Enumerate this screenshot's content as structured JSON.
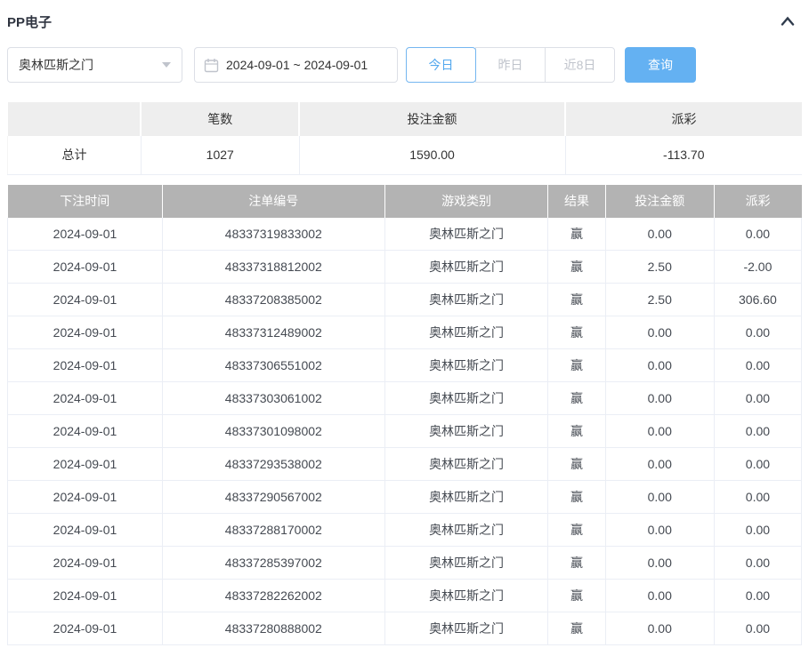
{
  "panel": {
    "title": "PP电子"
  },
  "filters": {
    "game_select": {
      "value": "奥林匹斯之门"
    },
    "date_range": {
      "value": "2024-09-01 ~ 2024-09-01"
    },
    "quick_buttons": [
      {
        "label": "今日",
        "active": true
      },
      {
        "label": "昨日",
        "active": false
      },
      {
        "label": "近8日",
        "active": false
      }
    ],
    "search_button": "查询"
  },
  "summary": {
    "columns": [
      "",
      "笔数",
      "投注金额",
      "派彩"
    ],
    "row": {
      "label": "总计",
      "count": "1027",
      "bet_amount": "1590.00",
      "payout": "-113.70"
    }
  },
  "table": {
    "columns": [
      "下注时间",
      "注单编号",
      "游戏类别",
      "结果",
      "投注金额",
      "派彩"
    ],
    "column_keys": [
      "bet-time",
      "bet-id",
      "game-type",
      "result",
      "bet-amount",
      "payout"
    ],
    "rows": [
      [
        "2024-09-01",
        "48337319833002",
        "奥林匹斯之门",
        "赢",
        "0.00",
        "0.00"
      ],
      [
        "2024-09-01",
        "48337318812002",
        "奥林匹斯之门",
        "赢",
        "2.50",
        "-2.00"
      ],
      [
        "2024-09-01",
        "48337208385002",
        "奥林匹斯之门",
        "赢",
        "2.50",
        "306.60"
      ],
      [
        "2024-09-01",
        "48337312489002",
        "奥林匹斯之门",
        "赢",
        "0.00",
        "0.00"
      ],
      [
        "2024-09-01",
        "48337306551002",
        "奥林匹斯之门",
        "赢",
        "0.00",
        "0.00"
      ],
      [
        "2024-09-01",
        "48337303061002",
        "奥林匹斯之门",
        "赢",
        "0.00",
        "0.00"
      ],
      [
        "2024-09-01",
        "48337301098002",
        "奥林匹斯之门",
        "赢",
        "0.00",
        "0.00"
      ],
      [
        "2024-09-01",
        "48337293538002",
        "奥林匹斯之门",
        "赢",
        "0.00",
        "0.00"
      ],
      [
        "2024-09-01",
        "48337290567002",
        "奥林匹斯之门",
        "赢",
        "0.00",
        "0.00"
      ],
      [
        "2024-09-01",
        "48337288170002",
        "奥林匹斯之门",
        "赢",
        "0.00",
        "0.00"
      ],
      [
        "2024-09-01",
        "48337285397002",
        "奥林匹斯之门",
        "赢",
        "0.00",
        "0.00"
      ],
      [
        "2024-09-01",
        "48337282262002",
        "奥林匹斯之门",
        "赢",
        "0.00",
        "0.00"
      ],
      [
        "2024-09-01",
        "48337280888002",
        "奥林匹斯之门",
        "赢",
        "0.00",
        "0.00"
      ]
    ]
  },
  "colors": {
    "accent_blue": "#64b1f2",
    "active_tab_blue": "#53a8ee",
    "negative_red": "#f35b5b",
    "table_header_gray": "#b3b3b3",
    "summary_header_gray": "#eeeeee"
  }
}
